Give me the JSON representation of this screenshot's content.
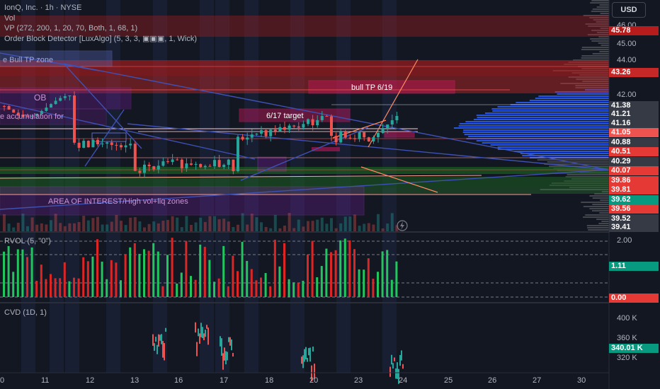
{
  "colors": {
    "background": "#131722",
    "up": "#26a69a",
    "down": "#ef5350",
    "vol_up": "#22c55e",
    "vol_down": "#dc2626",
    "poc": "#2962ff",
    "line_blue": "#3f51b5",
    "zone_red": "#b71c1c",
    "zone_green": "#1b5e20"
  },
  "header": {
    "usd_label": "USD",
    "symbol_line": "IonQ, Inc. · 1h · NYSE",
    "vol_line": "Vol",
    "vp_line": "VP (272, 200, 1, 20, 70, Both, 1, 68, 1)",
    "ob_line": "Order Block Detector [LuxAlgo] (5, 3, 3, ▣▣▣, 1, Wick)"
  },
  "annotations": {
    "bull_tp_zone": "e Bull TP zone",
    "ob_label": "OB",
    "accumulation": "e accumulation for",
    "target_617": "6/17 target",
    "bull_tp_619": "bull TP 6/19",
    "area_interest": "AREA OF INTEREST/High vol+liq zones"
  },
  "price_axis": {
    "ticks": [
      "46.00",
      "45.00",
      "44.00",
      "42.00"
    ],
    "badges": [
      {
        "label": "45.78",
        "color": "#b71c1c"
      },
      {
        "label": "43.26",
        "color": "#c62828"
      },
      {
        "label": "41.38",
        "color": "#363a45"
      },
      {
        "label": "41.21",
        "color": "#363a45"
      },
      {
        "label": "41.16",
        "color": "#363a45"
      },
      {
        "label": "41.05",
        "color": "#ef5350"
      },
      {
        "label": "40.88",
        "color": "#363a45"
      },
      {
        "label": "40.51",
        "color": "#e53935"
      },
      {
        "label": "40.29",
        "color": "#363a45"
      },
      {
        "label": "40.07",
        "color": "#e53935"
      },
      {
        "label": "39.86",
        "color": "#e53935"
      },
      {
        "label": "39.81",
        "color": "#e53935"
      },
      {
        "label": "39.62",
        "color": "#089981"
      },
      {
        "label": "39.56",
        "color": "#e53935"
      },
      {
        "label": "39.52",
        "color": "#363a45"
      },
      {
        "label": "39.41",
        "color": "#363a45"
      }
    ]
  },
  "rvol": {
    "label": "RVOL (5, \"0\")",
    "axis_top": "2.00",
    "value_badge": "1.11",
    "zero_badge": "0.00"
  },
  "cvd": {
    "label": "CVD (1D, 1)",
    "ticks": [
      "400 K",
      "360 K",
      "320 K"
    ],
    "value_badge": "340.01 K"
  },
  "date_axis": [
    "0",
    "11",
    "12",
    "13",
    "16",
    "17",
    "18",
    "20",
    "23",
    "24",
    "25",
    "26",
    "27",
    "30"
  ]
}
